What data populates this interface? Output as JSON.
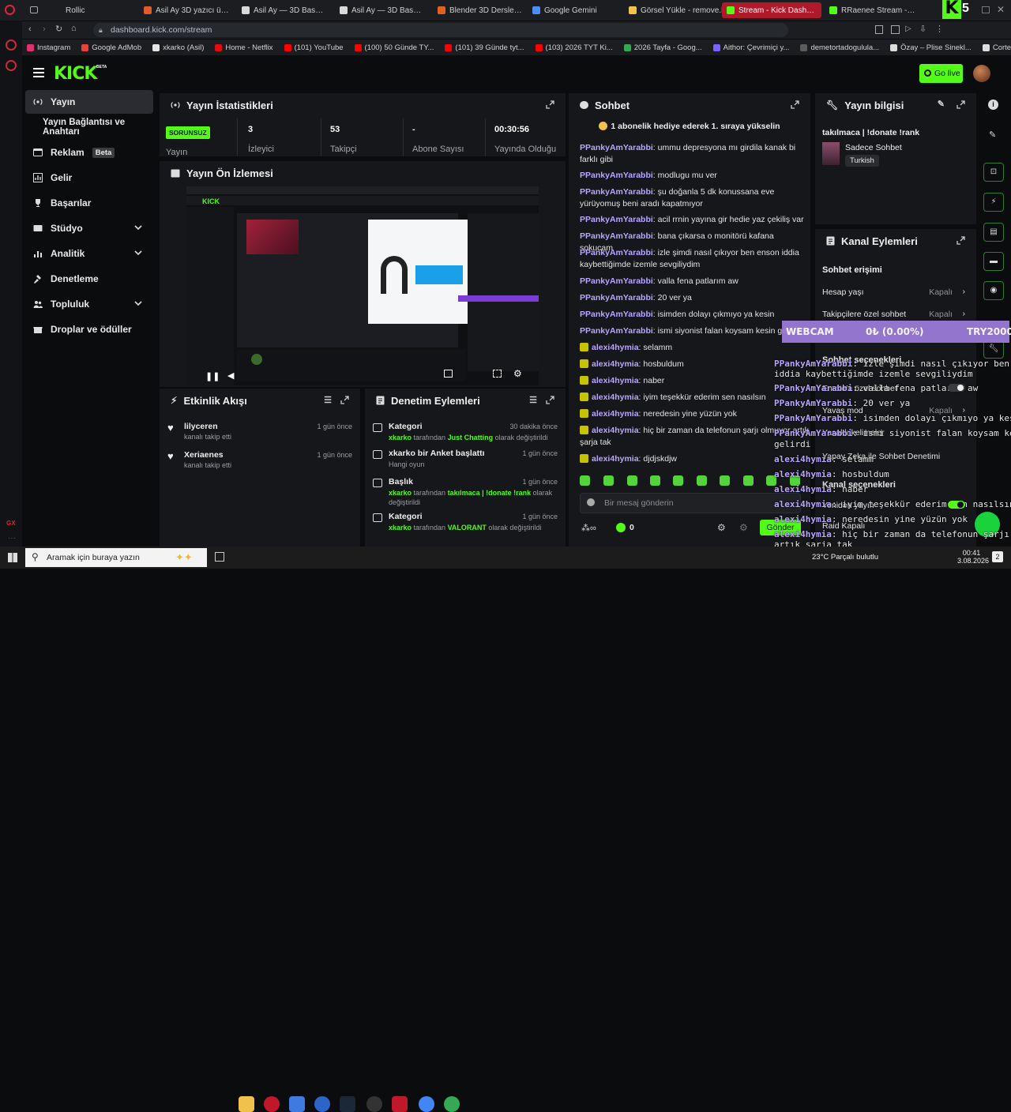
{
  "browser": {
    "tabs": [
      {
        "label": "Rollic",
        "color": "#3e4250"
      },
      {
        "label": "Asil Ay 3D yazıcı ürün sat",
        "color": "#e05a2b"
      },
      {
        "label": "Asil Ay — 3D Baskı & Dijit",
        "color": "#d9d9d9"
      },
      {
        "label": "Asil Ay — 3D Baskı & Dijit",
        "color": "#d9d9d9"
      },
      {
        "label": "Blender 3D Dersleri: Obje",
        "color": "#e0621c"
      },
      {
        "label": "Google Gemini",
        "color": "#4c8df6"
      },
      {
        "label": "Görsel Yükle - remove.bg",
        "color": "#f2c14e"
      },
      {
        "label": "Stream - Kick Dashboard",
        "color": "#53fc18"
      },
      {
        "label": "RRaenee Stream - Wa",
        "color": "#53fc18"
      }
    ],
    "url": "dashboard.kick.com/stream",
    "bookmarks": [
      {
        "label": "Instagram",
        "color": "#e1306c"
      },
      {
        "label": "Google AdMob",
        "color": "#ea4335"
      },
      {
        "label": "xkarko (Asil)",
        "color": "#e6e6e6"
      },
      {
        "label": "Home - Netflix",
        "color": "#e50914"
      },
      {
        "label": "(101) YouTube",
        "color": "#ff0000"
      },
      {
        "label": "(100) 50 Günde TY...",
        "color": "#ff0000"
      },
      {
        "label": "(101) 39 Günde tyt...",
        "color": "#ff0000"
      },
      {
        "label": "(103) 2026 TYT Ki...",
        "color": "#ff0000"
      },
      {
        "label": "2026 Tayfa - Goog...",
        "color": "#34a853"
      },
      {
        "label": "Aithor: Çevrimiçi y...",
        "color": "#7b61ff"
      },
      {
        "label": "demetortadogulula...",
        "color": "#5c5c5c"
      },
      {
        "label": "Özay – Plise Sinekl...",
        "color": "#dddddd"
      },
      {
        "label": "Corteiz Woosh Me...",
        "color": "#dddddd"
      }
    ]
  },
  "header": {
    "logo": "KICK",
    "logo_badge": "BETA",
    "go_live": "Go live"
  },
  "sidebar": {
    "items": [
      {
        "label": "Yayın",
        "icon": "broadcast-icon"
      },
      {
        "label": "Yayın Bağlantısı ve Anahtarı",
        "icon": ""
      },
      {
        "label": "Reklam",
        "badge": "Beta",
        "icon": "ad-icon"
      },
      {
        "label": "Gelir",
        "icon": "revenue-icon"
      },
      {
        "label": "Başarılar",
        "icon": "trophy-icon"
      },
      {
        "label": "Stüdyo",
        "icon": "studio-icon"
      },
      {
        "label": "Analitik",
        "icon": "analytics-icon"
      },
      {
        "label": "Denetleme",
        "icon": "hammer-icon"
      },
      {
        "label": "Topluluk",
        "icon": "community-icon"
      },
      {
        "label": "Droplar ve ödüller",
        "icon": "gift-icon"
      }
    ]
  },
  "stats": {
    "title": "Yayın İstatistikleri",
    "status": "SORUNSUZ",
    "items": [
      {
        "value": "",
        "label": "Yayın"
      },
      {
        "value": "3",
        "label": "İzleyici"
      },
      {
        "value": "53",
        "label": "Takipçi"
      },
      {
        "value": "-",
        "label": "Abone Sayısı"
      },
      {
        "value": "00:30:56",
        "label": "Yayında Olduğu"
      }
    ]
  },
  "preview": {
    "title": "Yayın Ön İzlemesi"
  },
  "activity": {
    "title": "Etkinlik Akışı",
    "items": [
      {
        "name": "lilyceren",
        "desc": "kanalı takip etti",
        "time": "1 gün önce"
      },
      {
        "name": "Xeriaenes",
        "desc": "kanalı takip etti",
        "time": "1 gün önce"
      }
    ]
  },
  "moderation": {
    "title": "Denetim Eylemleri",
    "items": [
      {
        "title": "Kategori",
        "time": "30 dakika önce",
        "line1_user": "xkarko",
        "line1_mid": " tarafından ",
        "line1_val": "Just Chatting",
        "line1_end": " olarak değiştirildi",
        "line2": ""
      },
      {
        "title": "xkarko bir Anket başlattı",
        "time": "1 gün önce",
        "line1_user": "",
        "line1_mid": "",
        "line1_val": "",
        "line1_end": "Hangi oyun",
        "line2": ""
      },
      {
        "title": "Başlık",
        "time": "1 gün önce",
        "line1_user": "xkarko",
        "line1_mid": " tarafından ",
        "line1_val": "takılmaca | !donate !rank",
        "line1_end": " olarak",
        "line2": "değiştirildi"
      },
      {
        "title": "Kategori",
        "time": "1 gün önce",
        "line1_user": "xkarko",
        "line1_mid": " tarafından ",
        "line1_val": "VALORANT",
        "line1_end": " olarak değiştirildi",
        "line2": ""
      }
    ]
  },
  "chat": {
    "title": "Sohbet",
    "pinned": "1 abonelik hediye ederek 1. sıraya yükselin",
    "messages": [
      {
        "user": "PPankyAmYarabbi",
        "text": "ummu depresyona mı girdila kanak bi farklı gibi"
      },
      {
        "user": "PPankyAmYarabbi",
        "text": "modlugu mu ver"
      },
      {
        "user": "PPankyAmYarabbi",
        "text": "şu doğanla 5 dk konussana eve yürüyomuş beni aradı kapatmıyor"
      },
      {
        "user": "PPankyAmYarabbi",
        "text": "acil rrnin yayına gir hedie yaz çekiliş var"
      },
      {
        "user": "PPankyAmYarabbi",
        "text": "bana çıkarsa o monitörü kafana sokucam"
      },
      {
        "user": "PPankyAmYarabbi",
        "text": "izle şimdi nasıl çıkıyor ben enson iddia kaybettiğimde izemle sevgiliydim"
      },
      {
        "user": "PPankyAmYarabbi",
        "text": "valla fena patlarım aw"
      },
      {
        "user": "PPankyAmYarabbi",
        "text": "20 ver ya"
      },
      {
        "user": "PPankyAmYarabbi",
        "text": "isimden dolayı çıkmıyo ya kesin"
      },
      {
        "user": "PPankyAmYarabbi",
        "text": "ismi siyonist falan koysam kesin gelirdi"
      },
      {
        "user": "alexi4hymia",
        "text": "selamm"
      },
      {
        "user": "alexi4hymia",
        "text": "hosbuldum"
      },
      {
        "user": "alexi4hymia",
        "text": "naber"
      },
      {
        "user": "alexi4hymia",
        "text": "iyim teşekkür ederim sen nasılsın"
      },
      {
        "user": "alexi4hymia",
        "text": "neredesin yine yüzün yok"
      },
      {
        "user": "alexi4hymia",
        "text": "hiç bir zaman da telefonun şarjı olmuyor artık şarja tak"
      },
      {
        "user": "alexi4hymia",
        "text": "djdjskdjw"
      }
    ],
    "input_placeholder": "Bir mesaj gönderin",
    "points": "0",
    "send": "Gönder"
  },
  "stream_info": {
    "title": "Yayın bilgisi",
    "stream_title": "takılmaca | !donate !rank",
    "category": "Sadece Sohbet",
    "tag": "Turkish"
  },
  "channel_actions": {
    "title": "Kanal Eylemleri",
    "section": "Sohbet erişimi",
    "rows": [
      {
        "label": "Hesap yaşı",
        "value": "Kapalı"
      },
      {
        "label": "Takipçilere özel sohbet",
        "value": "Kapalı"
      },
      {
        "label": "Sohbet seçenekleri",
        "value": ""
      },
      {
        "label": "Emote'a özel sohbet",
        "value": ""
      },
      {
        "label": "Yavaş mod",
        "value": "Kapalı"
      },
      {
        "label": "Yasaklı kelimeler",
        "value": ""
      },
      {
        "label": "Yapay Zeka ile Sohbet Denetimi",
        "value": ""
      },
      {
        "label": "Kanal seçenekleri",
        "value": ""
      },
      {
        "label": "Yeniden yayın",
        "value": ""
      },
      {
        "label": "Raid Kapalı",
        "value": ""
      }
    ]
  },
  "webcam_overlay": {
    "label": "WEBCAM",
    "value": "0₺ (0.00%)",
    "amount": "TRY2000"
  },
  "overlay_chat": [
    {
      "user": "PPankyAmYarabbi",
      "text": "izle şimdi nasıl çıkıyor ben enson"
    },
    {
      "user": "",
      "text": "iddia kaybettiğimde izemle sevgiliydim"
    },
    {
      "user": "PPankyAmYarabbi",
      "text": "valla fena patlarım aw"
    },
    {
      "user": "PPankyAmYarabbi",
      "text": "20 ver ya"
    },
    {
      "user": "PPankyAmYarabbi",
      "text": "isimden dolayı çıkmıyo ya kesin"
    },
    {
      "user": "PPankyAmYarabbi",
      "text": "ismi siyonist falan koysam kesin"
    },
    {
      "user": "",
      "text": "gelirdi"
    },
    {
      "user": "alexi4hymia",
      "text": "selamm"
    },
    {
      "user": "alexi4hymia",
      "text": "hosbuldum"
    },
    {
      "user": "alexi4hymia",
      "text": "naber"
    },
    {
      "user": "alexi4hymia",
      "text": "iyim teşekkür ederim sen nasılsın"
    },
    {
      "user": "alexi4hymia",
      "text": "neredesin yine yüzün yok"
    },
    {
      "user": "alexi4hymia",
      "text": "hiç bir zaman da telefonun şarjı olmuyor"
    },
    {
      "user": "",
      "text": "artık şarja tak"
    },
    {
      "user": "alexi4hymia",
      "text": "djdjskdjw"
    }
  ],
  "taskbar": {
    "search": "Aramak için buraya yazın",
    "weather": "23°C  Parçalı bulutlu",
    "time": "00:41",
    "date": "3.08.2026",
    "notif": "2"
  },
  "colors": {
    "kick_green": "#53fc18",
    "brand_red": "#b0192a",
    "panel": "#16171a",
    "user_purple": "#b9a6ff"
  }
}
